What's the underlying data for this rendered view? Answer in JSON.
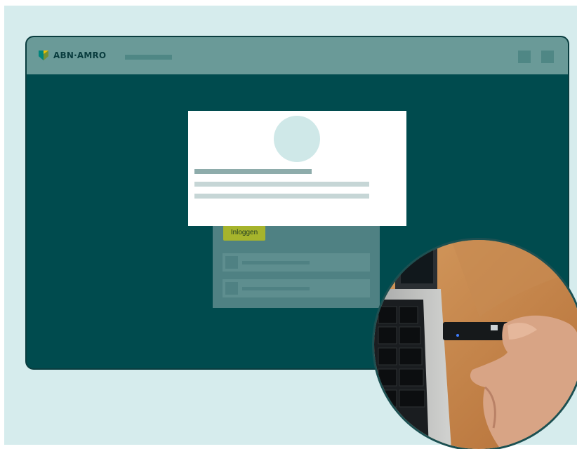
{
  "brand": {
    "name": "ABN·AMRO",
    "logo_icon": "abn-amro-shield-icon",
    "colors": {
      "primary": "#004b4e",
      "accent": "#a6b42c",
      "background": "#d6eced",
      "titlebar": "#6a9a98"
    }
  },
  "login": {
    "button_label": "Inloggen"
  },
  "photo": {
    "icon": "usb-security-key-photo"
  }
}
